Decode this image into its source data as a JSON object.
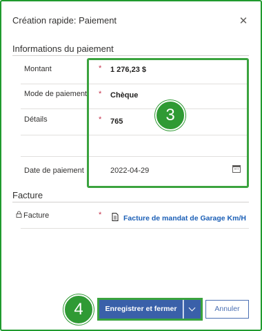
{
  "dialog": {
    "title": "Création rapide: Paiement",
    "close_icon": "close-icon"
  },
  "payment_section": {
    "title": "Informations du paiement",
    "fields": {
      "amount": {
        "label": "Montant",
        "required_mark": "*",
        "value": "1 276,23 $"
      },
      "method": {
        "label": "Mode de paiement",
        "required_mark": "*",
        "value": "Chèque"
      },
      "details": {
        "label": "Détails",
        "required_mark": "*",
        "value": "765"
      },
      "date": {
        "label": "Date de paiement",
        "value": "2022-04-29",
        "icon": "calendar-icon"
      }
    }
  },
  "invoice_section": {
    "title": "Facture",
    "field": {
      "label": "Facture",
      "required_mark": "*",
      "value": "Facture de mandat de Garage Km/H",
      "lock_icon": "lock-icon",
      "doc_icon": "document-icon"
    }
  },
  "annotations": {
    "badge_3": "3",
    "badge_4": "4"
  },
  "footer": {
    "save_label": "Enregistrer et fermer",
    "cancel_label": "Annuler"
  },
  "colors": {
    "highlight_green": "#3aa33e",
    "primary_blue": "#3a60a9",
    "link_blue": "#1b5fb6",
    "required_red": "#c4314b"
  }
}
